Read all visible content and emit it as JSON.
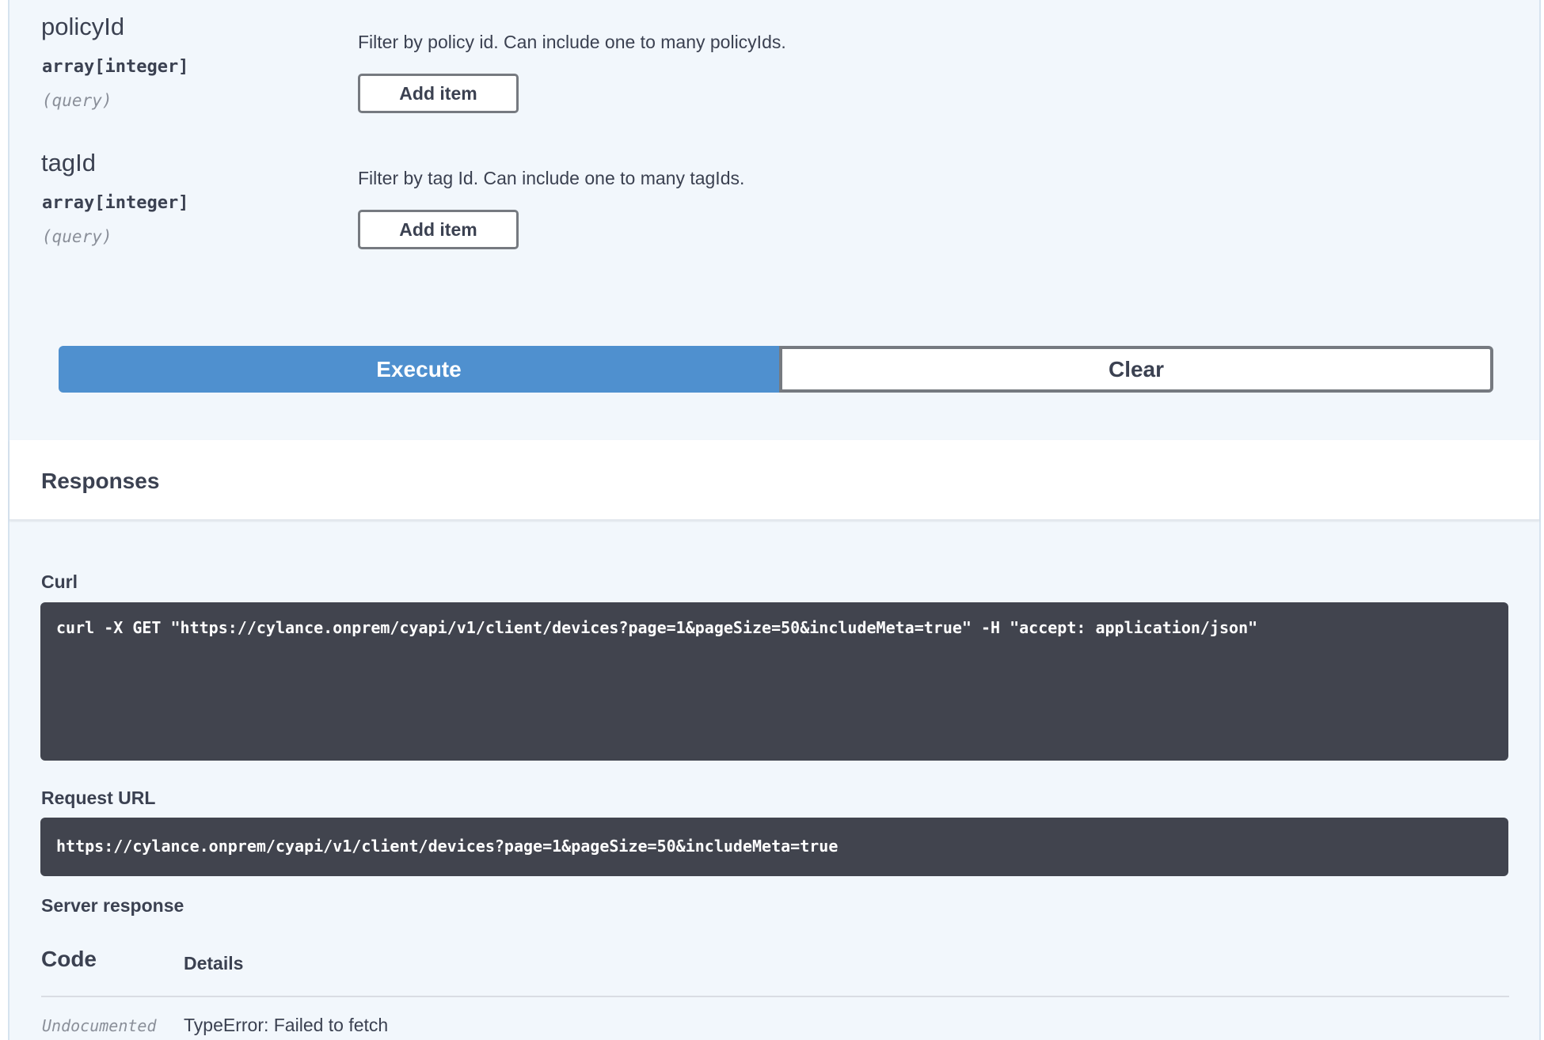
{
  "parameters": [
    {
      "name": "policyId",
      "type": "array[integer]",
      "in": "(query)",
      "description": "Filter by policy id. Can include one to many policyIds.",
      "add_label": "Add item"
    },
    {
      "name": "tagId",
      "type": "array[integer]",
      "in": "(query)",
      "description": "Filter by tag Id. Can include one to many tagIds.",
      "add_label": "Add item"
    }
  ],
  "actions": {
    "execute_label": "Execute",
    "clear_label": "Clear",
    "execute_color": "#4f90cf"
  },
  "responses": {
    "title": "Responses",
    "curl_label": "Curl",
    "curl_command": "curl -X GET \"https://cylance.onprem/cyapi/v1/client/devices?page=1&pageSize=50&includeMeta=true\" -H \"accept: application/json\"",
    "request_url_label": "Request URL",
    "request_url": "https://cylance.onprem/cyapi/v1/client/devices?page=1&pageSize=50&includeMeta=true",
    "server_response_label": "Server response",
    "table": {
      "code_header": "Code",
      "details_header": "Details",
      "rows": [
        {
          "code": "Undocumented",
          "details": "TypeError: Failed to fetch"
        }
      ]
    }
  }
}
